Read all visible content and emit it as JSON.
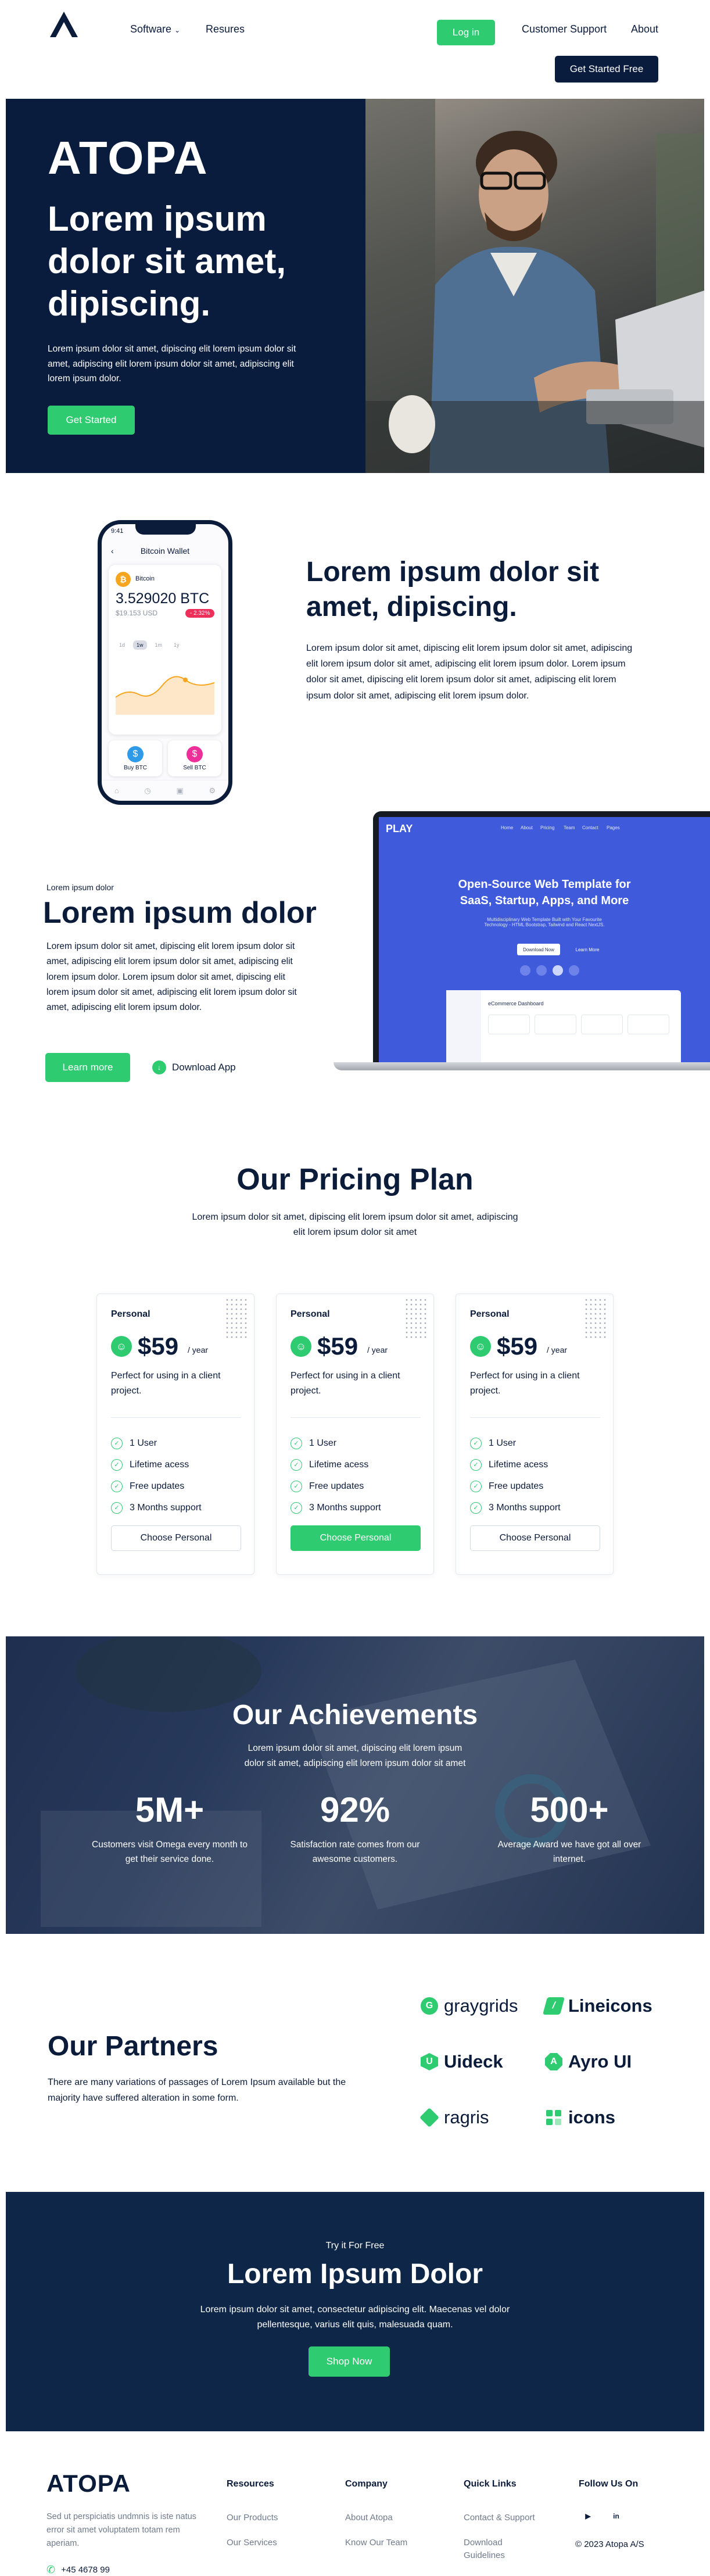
{
  "nav": {
    "software": "Software",
    "resources": "Resures",
    "login": "Log in",
    "support": "Customer Support",
    "about": "About",
    "cta": "Get Started Free"
  },
  "hero": {
    "brand": "ATOPA",
    "title": "Lorem ipsum dolor sit amet, dipiscing.",
    "text": "Lorem ipsum dolor sit amet, dipiscing elit lorem ipsum dolor sit amet, adipiscing elit lorem ipsum dolor sit amet, adipiscing elit lorem ipsum dolor.",
    "button": "Get Started"
  },
  "wallet": {
    "time": "9:41",
    "title": "Bitcoin Wallet",
    "coin": "Bitcoin",
    "amount": "3.529020 BTC",
    "usd": "$19.153 USD",
    "change": "- 2.32%",
    "tabs": [
      "1d",
      "1w",
      "1m",
      "1y"
    ],
    "buy": "Buy BTC",
    "sell": "Sell BTC"
  },
  "feature1": {
    "title": "Lorem ipsum dolor sit amet, dipiscing.",
    "text": "Lorem ipsum dolor sit amet, dipiscing elit lorem ipsum dolor sit amet, adipiscing elit lorem ipsum dolor sit amet, adipiscing elit lorem ipsum dolor. Lorem ipsum dolor sit amet, dipiscing elit lorem ipsum dolor sit amet, adipiscing elit lorem ipsum dolor sit amet, adipiscing elit lorem ipsum dolor."
  },
  "laptop": {
    "brand": "PLAY",
    "nav": [
      "Home",
      "About",
      "Pricing",
      "Team",
      "Contact",
      "Pages"
    ],
    "headline": "Open-Source Web Template for SaaS, Startup, Apps, and More",
    "sub": "Multidisciplinary Web Template Built with Your Favourite Technology - HTML Bootstrap, Tailwind and React NextJS.",
    "btn1": "Download Now",
    "btn2": "Learn More",
    "dash": "eCommerce Dashboard"
  },
  "feature2": {
    "small": "Lorem ipsum dolor",
    "title": "Lorem ipsum dolor",
    "text": "Lorem ipsum dolor sit amet, dipiscing elit lorem ipsum dolor sit amet, adipiscing elit lorem ipsum dolor sit amet, adipiscing elit lorem ipsum dolor. Lorem ipsum dolor sit amet, dipiscing elit lorem ipsum dolor sit amet, adipiscing elit lorem ipsum dolor sit amet, adipiscing elit lorem ipsum dolor.",
    "button": "Learn more",
    "download": "Download App"
  },
  "pricing": {
    "title": "Our Pricing Plan",
    "text": "Lorem ipsum dolor sit amet, dipiscing elit lorem ipsum dolor sit amet, adipiscing elit lorem ipsum dolor sit amet",
    "plans": [
      {
        "name": "Personal",
        "price": "$59",
        "per": "/ year",
        "desc": "Perfect for using in a client project.",
        "features": [
          "1 User",
          "Lifetime acess",
          "Free updates",
          "3 Months support"
        ],
        "button": "Choose Personal"
      },
      {
        "name": "Personal",
        "price": "$59",
        "per": "/ year",
        "desc": "Perfect for using in a client project.",
        "features": [
          "1 User",
          "Lifetime acess",
          "Free updates",
          "3 Months support"
        ],
        "button": "Choose Personal"
      },
      {
        "name": "Personal",
        "price": "$59",
        "per": "/ year",
        "desc": "Perfect for using in a client project.",
        "features": [
          "1 User",
          "Lifetime acess",
          "Free updates",
          "3 Months support"
        ],
        "button": "Choose Personal"
      }
    ]
  },
  "achievements": {
    "title": "Our Achievements",
    "text": "Lorem ipsum dolor sit amet, dipiscing elit lorem ipsum dolor sit amet, adipiscing elit lorem ipsum dolor sit amet",
    "stats": [
      {
        "value": "5M+",
        "label": "Customers visit Omega every month to get their service done."
      },
      {
        "value": "92%",
        "label": "Satisfaction rate comes from our awesome customers."
      },
      {
        "value": "500+",
        "label": "Average Award we have got all over internet."
      }
    ]
  },
  "partners": {
    "title": "Our Partners",
    "text": "There are many variations of passages of Lorem Ipsum available but the majority have suffered alteration in some form.",
    "logos": [
      "graygrids",
      "Lineicons",
      "Uideck",
      "Ayro UI",
      "ragris",
      "icons"
    ]
  },
  "cta": {
    "small": "Try it For Free",
    "title": "Lorem Ipsum Dolor",
    "text": "Lorem ipsum dolor sit amet, consectetur adipiscing elit. Maecenas vel dolor pellentesque, varius elit quis, malesuada quam.",
    "button": "Shop Now"
  },
  "footer": {
    "brand": "ATOPA",
    "about": "Sed ut perspiciatis undmnis is iste natus error sit amet voluptatem totam rem aperiam.",
    "phone": "+45 4678 99",
    "cols": [
      {
        "head": "Resources",
        "links": [
          "Our Products",
          "Our Services"
        ]
      },
      {
        "head": "Company",
        "links": [
          "About Atopa",
          "Know Our Team"
        ]
      },
      {
        "head": "Quick Links",
        "links": [
          "Contact & Support",
          "Download Guidelines"
        ]
      }
    ],
    "follow": "Follow Us On",
    "copyright": "© 2023 Atopa A/S"
  },
  "colors": {
    "navy": "#0a1c3e",
    "green": "#2fcb71",
    "blue": "#3f5bdc"
  },
  "icons": [
    "atopa-logo-icon",
    "chevron-down-icon",
    "check-icon",
    "phone-icon",
    "youtube-icon",
    "linkedin-icon"
  ]
}
